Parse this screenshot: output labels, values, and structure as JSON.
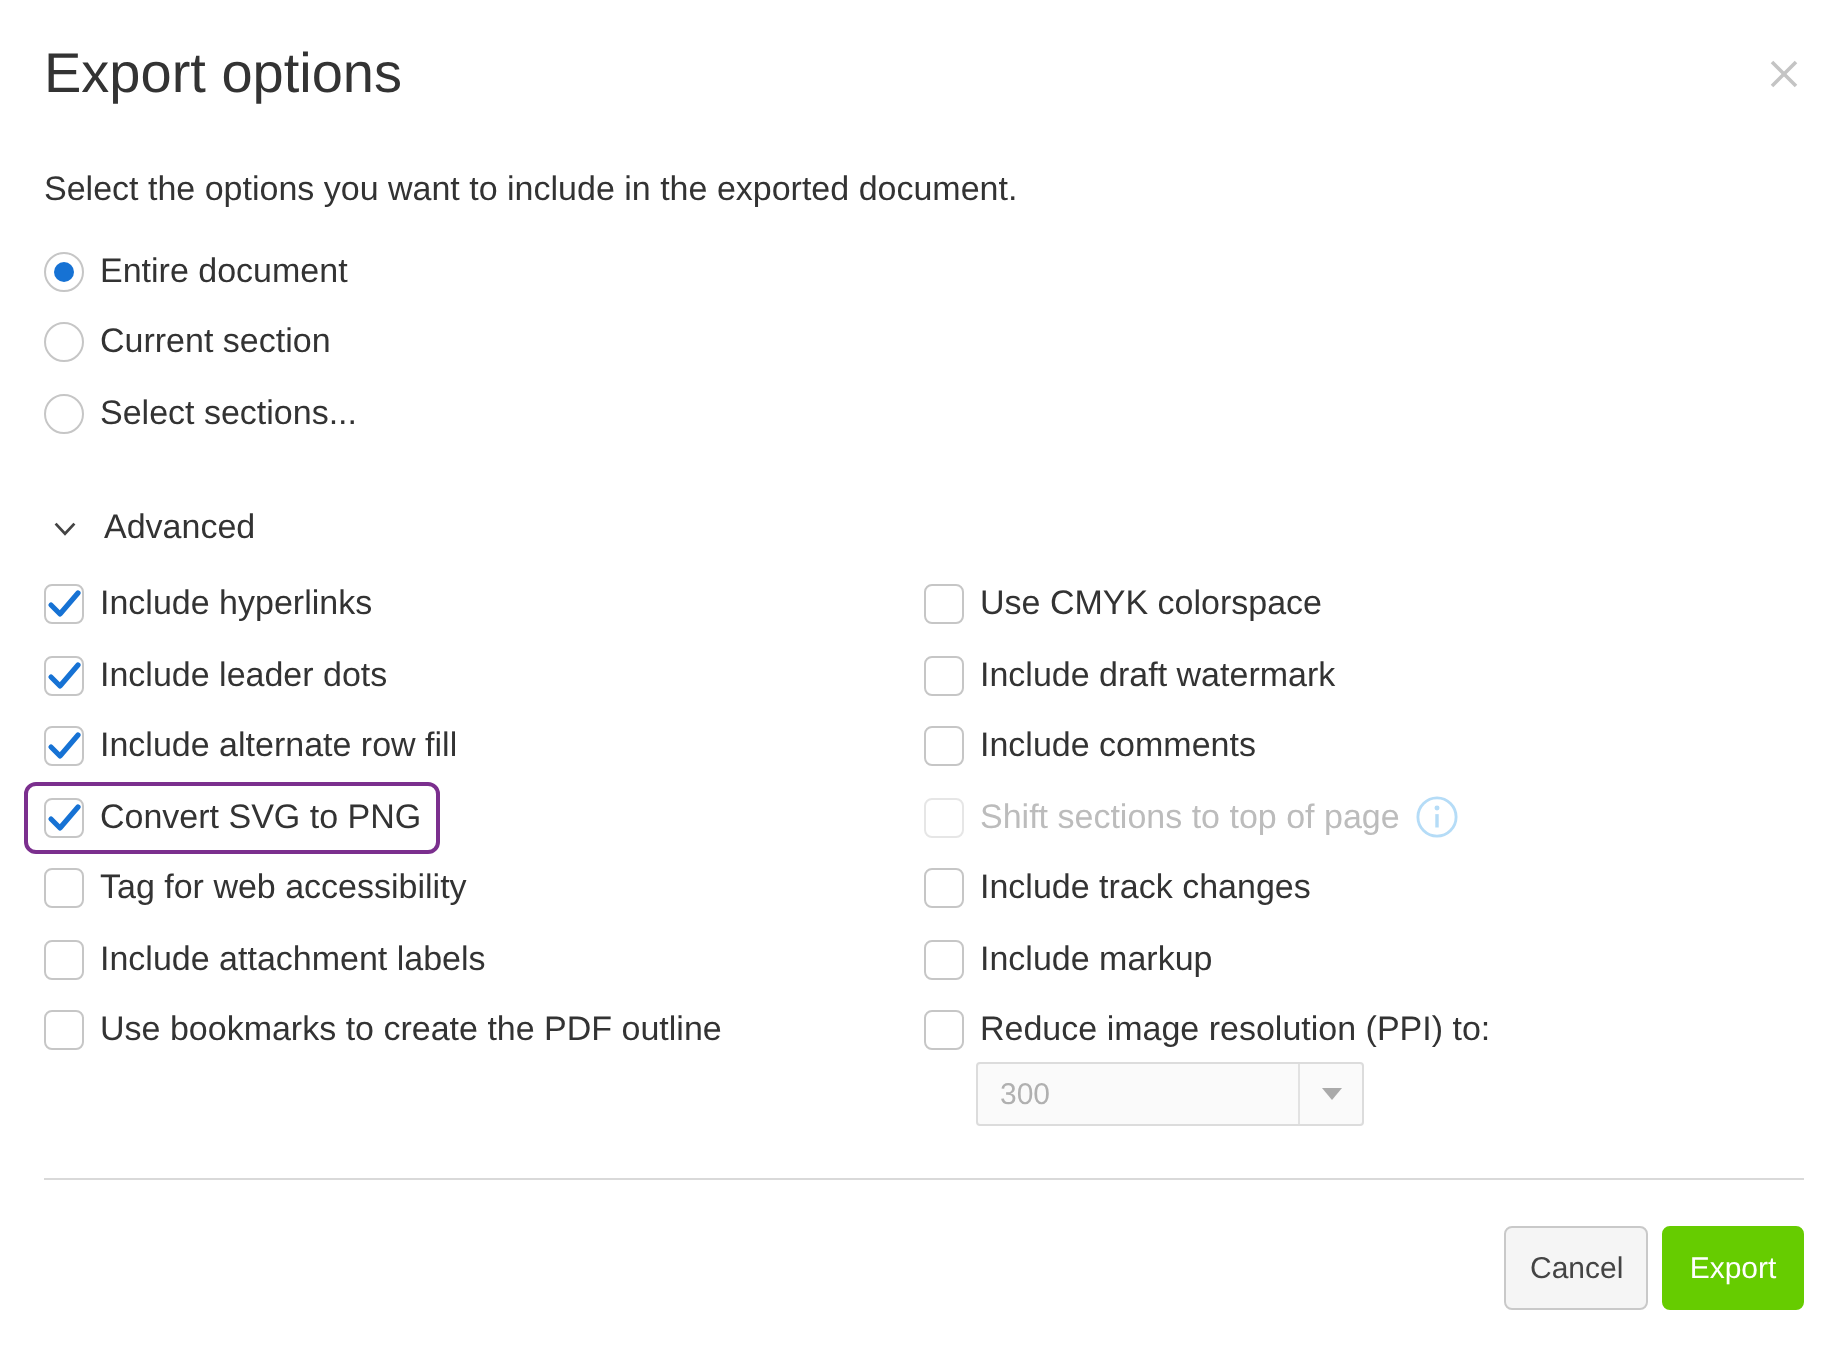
{
  "dialog": {
    "title": "Export options"
  },
  "description": "Select the options you want to include in the exported document.",
  "scope": [
    {
      "label": "Entire document",
      "selected": true
    },
    {
      "label": "Current section",
      "selected": false
    },
    {
      "label": "Select sections...",
      "selected": false
    }
  ],
  "advanced": {
    "label": "Advanced",
    "expanded": true
  },
  "options": {
    "left": [
      {
        "label": "Include hyperlinks",
        "checked": true,
        "disabled": false,
        "highlighted": false
      },
      {
        "label": "Include leader dots",
        "checked": true,
        "disabled": false,
        "highlighted": false
      },
      {
        "label": "Include alternate row fill",
        "checked": true,
        "disabled": false,
        "highlighted": false
      },
      {
        "label": "Convert SVG to PNG",
        "checked": true,
        "disabled": false,
        "highlighted": true
      },
      {
        "label": "Tag for web accessibility",
        "checked": false,
        "disabled": false,
        "highlighted": false
      },
      {
        "label": "Include attachment labels",
        "checked": false,
        "disabled": false,
        "highlighted": false
      },
      {
        "label": "Use bookmarks to create the PDF outline",
        "checked": false,
        "disabled": false,
        "highlighted": false
      }
    ],
    "right": [
      {
        "label": "Use CMYK colorspace",
        "checked": false,
        "disabled": false,
        "info": false
      },
      {
        "label": "Include draft watermark",
        "checked": false,
        "disabled": false,
        "info": false
      },
      {
        "label": "Include comments",
        "checked": false,
        "disabled": false,
        "info": false
      },
      {
        "label": "Shift sections to top of page",
        "checked": false,
        "disabled": true,
        "info": true
      },
      {
        "label": "Include track changes",
        "checked": false,
        "disabled": false,
        "info": false
      },
      {
        "label": "Include markup",
        "checked": false,
        "disabled": false,
        "info": false
      },
      {
        "label": "Reduce image resolution (PPI) to:",
        "checked": false,
        "disabled": false,
        "info": false
      }
    ]
  },
  "resolution": {
    "value": "300",
    "disabled": true
  },
  "buttons": [
    {
      "label": "Cancel",
      "kind": "secondary"
    },
    {
      "label": "Export",
      "kind": "primary"
    }
  ]
}
